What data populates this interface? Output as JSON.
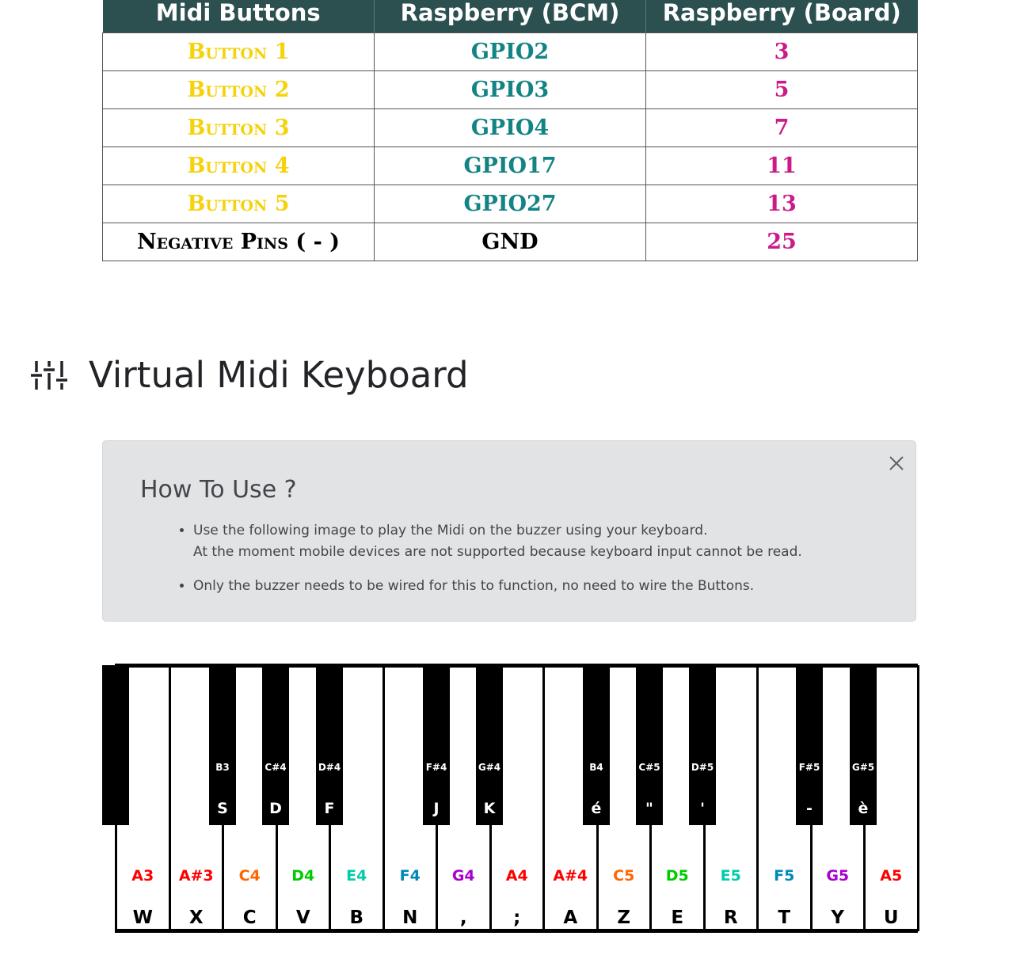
{
  "table": {
    "headers": [
      "Midi Buttons",
      "Raspberry (BCM)",
      "Raspberry (Board)"
    ],
    "rows": [
      {
        "button": "Button 1",
        "bcm": "GPIO2",
        "board": "3"
      },
      {
        "button": "Button 2",
        "bcm": "GPIO3",
        "board": "5"
      },
      {
        "button": "Button 3",
        "bcm": "GPIO4",
        "board": "7"
      },
      {
        "button": "Button 4",
        "bcm": "GPIO17",
        "board": "11"
      },
      {
        "button": "Button 5",
        "bcm": "GPIO27",
        "board": "13"
      },
      {
        "button": "Negative Pins ( - )",
        "bcm": "GND",
        "board": "25"
      }
    ]
  },
  "section": {
    "title": "Virtual Midi Keyboard",
    "icon": "sliders-icon"
  },
  "info": {
    "title": "How To Use ?",
    "items": [
      "Use the following image to play the Midi on the buzzer using your keyboard.",
      "At the moment mobile devices are not supported because keyboard input cannot be read.",
      "Only the buzzer needs to be wired for this to function, no need to wire the Buttons."
    ],
    "close_icon": "close-icon"
  },
  "keyboard": {
    "white_keys": [
      {
        "note": "A3",
        "key": "W",
        "color": "#ff0000"
      },
      {
        "note": "A#3",
        "key": "X",
        "color": "#ff0000"
      },
      {
        "note": "C4",
        "key": "C",
        "color": "#ff6600"
      },
      {
        "note": "D4",
        "key": "V",
        "color": "#00cc00"
      },
      {
        "note": "E4",
        "key": "B",
        "color": "#00ccaa"
      },
      {
        "note": "F4",
        "key": "N",
        "color": "#0088bb"
      },
      {
        "note": "G4",
        "key": ",",
        "color": "#aa00cc"
      },
      {
        "note": "A4",
        "key": ";",
        "color": "#ff0000"
      },
      {
        "note": "A#4",
        "key": "A",
        "color": "#ff0000"
      },
      {
        "note": "C5",
        "key": "Z",
        "color": "#ff6600"
      },
      {
        "note": "D5",
        "key": "E",
        "color": "#00cc00"
      },
      {
        "note": "E5",
        "key": "R",
        "color": "#00ccaa"
      },
      {
        "note": "F5",
        "key": "T",
        "color": "#0088bb"
      },
      {
        "note": "G5",
        "key": "Y",
        "color": "#aa00cc"
      },
      {
        "note": "A5",
        "key": "U",
        "color": "#ff0000"
      }
    ],
    "black_keys": [
      {
        "note": "",
        "key": ""
      },
      {
        "note": "B3",
        "key": "S"
      },
      {
        "note": "C#4",
        "key": "D"
      },
      {
        "note": "D#4",
        "key": "F"
      },
      {
        "note": "F#4",
        "key": "J"
      },
      {
        "note": "G#4",
        "key": "K"
      },
      {
        "note": "B4",
        "key": "é"
      },
      {
        "note": "C#5",
        "key": "\""
      },
      {
        "note": "D#5",
        "key": "'"
      },
      {
        "note": "F#5",
        "key": "-"
      },
      {
        "note": "G#5",
        "key": "è"
      }
    ]
  }
}
